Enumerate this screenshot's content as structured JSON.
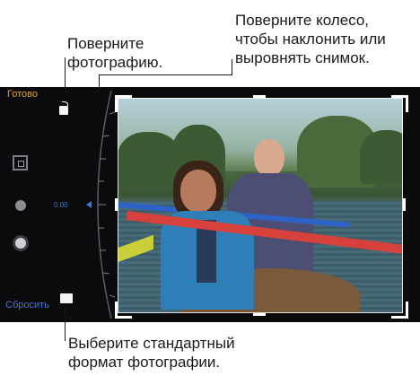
{
  "callouts": {
    "rotate_photo": [
      "Поверните",
      "фотографию."
    ],
    "turn_wheel": [
      "Поверните колесо,",
      "чтобы наклонить или",
      "выровнять снимок."
    ],
    "standard_format": [
      "Выберите стандартный",
      "формат фотографии."
    ]
  },
  "editor": {
    "done_label": "Готово",
    "reset_label": "Сбросить",
    "angle_label": "0.00"
  },
  "colors": {
    "accent": "#e3a522",
    "wheel_accent": "#3e7bd6"
  },
  "icons": {
    "rotate": "rotate-icon",
    "crop": "crop-icon",
    "dot": "adjust-icon",
    "sun": "light-icon",
    "aspect": "aspect-ratio-icon"
  }
}
